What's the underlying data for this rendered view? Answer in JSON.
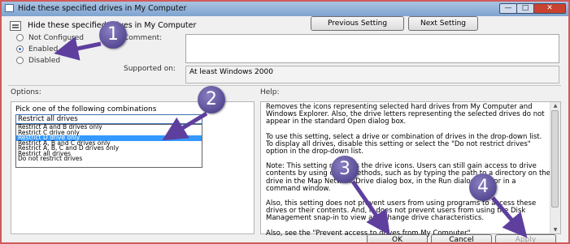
{
  "window": {
    "title": "Hide these specified drives in My Computer"
  },
  "header": {
    "policy_name": "Hide these specified drives in My Computer",
    "prev_button": "Previous Setting",
    "next_button": "Next Setting"
  },
  "state": {
    "options": [
      {
        "label": "Not Configured",
        "selected": false
      },
      {
        "label": "Enabled",
        "selected": true
      },
      {
        "label": "Disabled",
        "selected": false
      }
    ],
    "comment_label": "Comment:",
    "supported_label": "Supported on:",
    "supported_value": "At least Windows 2000"
  },
  "options": {
    "header": "Options:",
    "pick_label": "Pick one of the following combinations",
    "selected_value": "Restrict all drives",
    "items": [
      "Restrict A and B drives only",
      "Restrict C drive only",
      "Restrict D drive only",
      "Restrict A, B and C drives only",
      "Restrict A, B, C and D drives only",
      "Restrict all drives",
      "Do not restrict drives"
    ],
    "highlighted_index": 2
  },
  "help": {
    "header": "Help:",
    "paragraphs": [
      "Removes the icons representing selected hard drives from My Computer and Windows Explorer. Also, the drive letters representing the selected drives do not appear in the standard Open dialog box.",
      "To use this setting, select a drive or combination of drives in the drop-down list. To display all drives, disable this setting or select the \"Do not restrict drives\" option in the drop-down list.",
      "Note: This setting removes the drive icons. Users can still gain access to drive contents by using other methods, such as by typing the path to a directory on the drive in the Map Network Drive dialog box, in the Run dialog box, or in a command window.",
      "Also, this setting does not prevent users from using programs to access these drives or their contents. And, it does not prevent users from using the Disk Management snap-in to view and change drive characteristics.",
      "Also, see the \"Prevent access to drives from My Computer\""
    ]
  },
  "footer": {
    "ok": "OK",
    "cancel": "Cancel",
    "apply": "Apply"
  },
  "annotations": [
    "1",
    "2",
    "3",
    "4"
  ],
  "colors": {
    "badge": "#574a93",
    "arrow": "#5e3f9e",
    "selection": "#3399ff",
    "frame": "#d05a5a"
  }
}
